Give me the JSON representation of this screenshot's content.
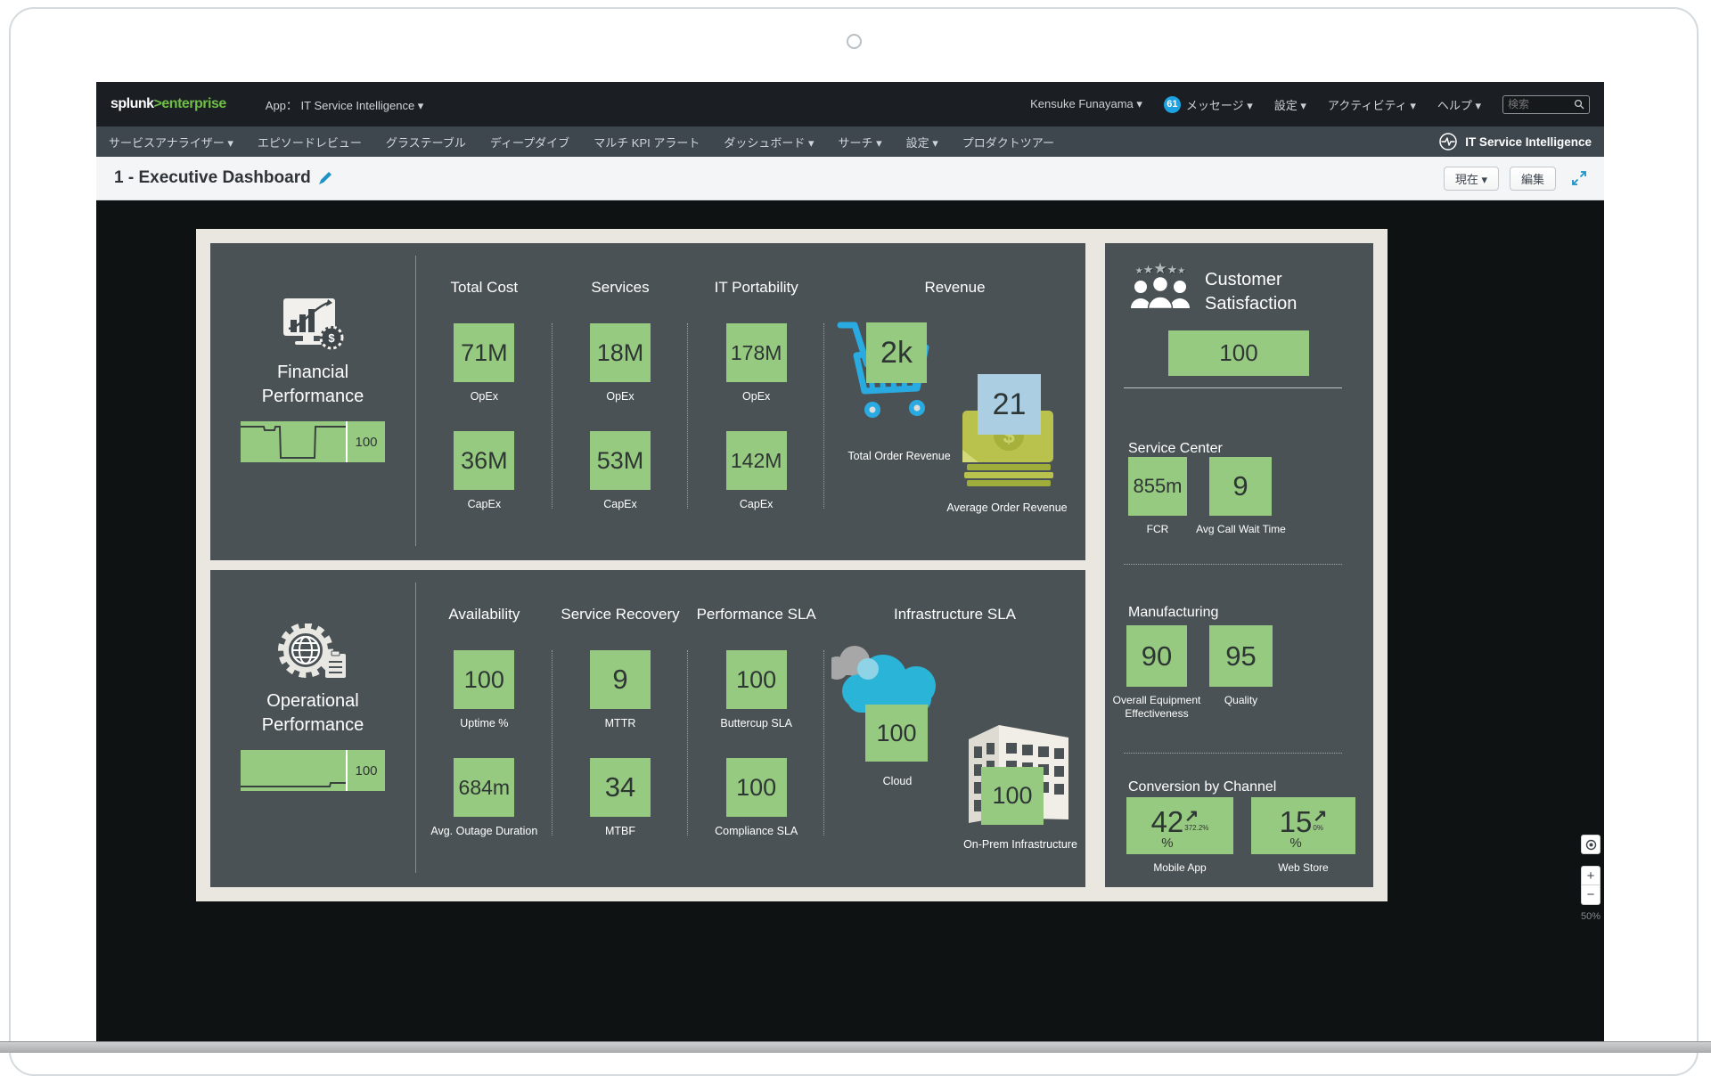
{
  "topbar": {
    "brand_left": "splunk",
    "brand_gt": ">",
    "brand_right": "enterprise",
    "app_menu": "App：  IT Service Intelligence ▾",
    "user": "Kensuke Funayama ▾",
    "badge": "61",
    "messages": "メッセージ ▾",
    "settings": "設定 ▾",
    "activity": "アクティビティ ▾",
    "help": "ヘルプ ▾",
    "search_placeholder": "検索"
  },
  "nav": {
    "items": [
      "サービスアナライザー ▾",
      "エピソードレビュー",
      "グラステーブル",
      "ディープダイブ",
      "マルチ KPI アラート",
      "ダッシュボード ▾",
      "サーチ ▾",
      "設定 ▾",
      "プロダクトツアー"
    ],
    "app_badge": "IT Service Intelligence"
  },
  "titlebar": {
    "title": "1 - Executive Dashboard",
    "current_button": "現在 ▾",
    "edit_button": "編集"
  },
  "financial": {
    "label_line1": "Financial",
    "label_line2": "Performance",
    "spark_value": "100",
    "col1": {
      "header": "Total Cost",
      "k1": "71M",
      "l1": "OpEx",
      "k2": "36M",
      "l2": "CapEx"
    },
    "col2": {
      "header": "Services",
      "k1": "18M",
      "l1": "OpEx",
      "k2": "53M",
      "l2": "CapEx"
    },
    "col3": {
      "header": "IT Portability",
      "k1": "178M",
      "l1": "OpEx",
      "k2": "142M",
      "l2": "CapEx"
    },
    "revenue": {
      "header": "Revenue",
      "cart_value": "2k",
      "cart_label": "Total Order Revenue",
      "avg_value": "21",
      "avg_label": "Average Order Revenue"
    }
  },
  "operational": {
    "label_line1": "Operational",
    "label_line2": "Performance",
    "spark_value": "100",
    "col1": {
      "header": "Availability",
      "k1": "100",
      "l1": "Uptime %",
      "k2": "684m",
      "l2": "Avg. Outage Duration"
    },
    "col2": {
      "header": "Service Recovery",
      "k1": "9",
      "l1": "MTTR",
      "k2": "34",
      "l2": "MTBF"
    },
    "col3": {
      "header": "Performance SLA",
      "k1": "100",
      "l1": "Buttercup SLA",
      "k2": "100",
      "l2": "Compliance SLA"
    },
    "infra": {
      "header": "Infrastructure SLA",
      "cloud_value": "100",
      "cloud_label": "Cloud",
      "onprem_value": "100",
      "onprem_label": "On-Prem Infrastructure"
    }
  },
  "customer": {
    "title_line1": "Customer",
    "title_line2": "Satisfaction",
    "score": "100",
    "service_center": {
      "title": "Service Center",
      "k1": "855m",
      "l1": "FCR",
      "k2": "9",
      "l2": "Avg Call Wait Time"
    },
    "manufacturing": {
      "title": "Manufacturing",
      "k1": "90",
      "l1": "Overall Equipment Effectiveness",
      "k2": "95",
      "l2": "Quality"
    },
    "conversion": {
      "title": "Conversion by Channel",
      "arrow": "↗",
      "k1": "42",
      "u1": "%",
      "t1": "372.2%",
      "l1": "Mobile App",
      "k2": "15",
      "u2": "%",
      "t2": "0%",
      "l2": "Web Store"
    }
  },
  "controls": {
    "zoom_in": "+",
    "zoom_out": "−",
    "zoom_level": "50%"
  },
  "colors": {
    "kpi_green": "#97ca81",
    "kpi_blue": "#accee3",
    "splunk_green": "#6fbe47",
    "link_blue": "#1e93c6",
    "panel_gray": "#4a5255",
    "dashboard_bg": "#eae7e0"
  }
}
